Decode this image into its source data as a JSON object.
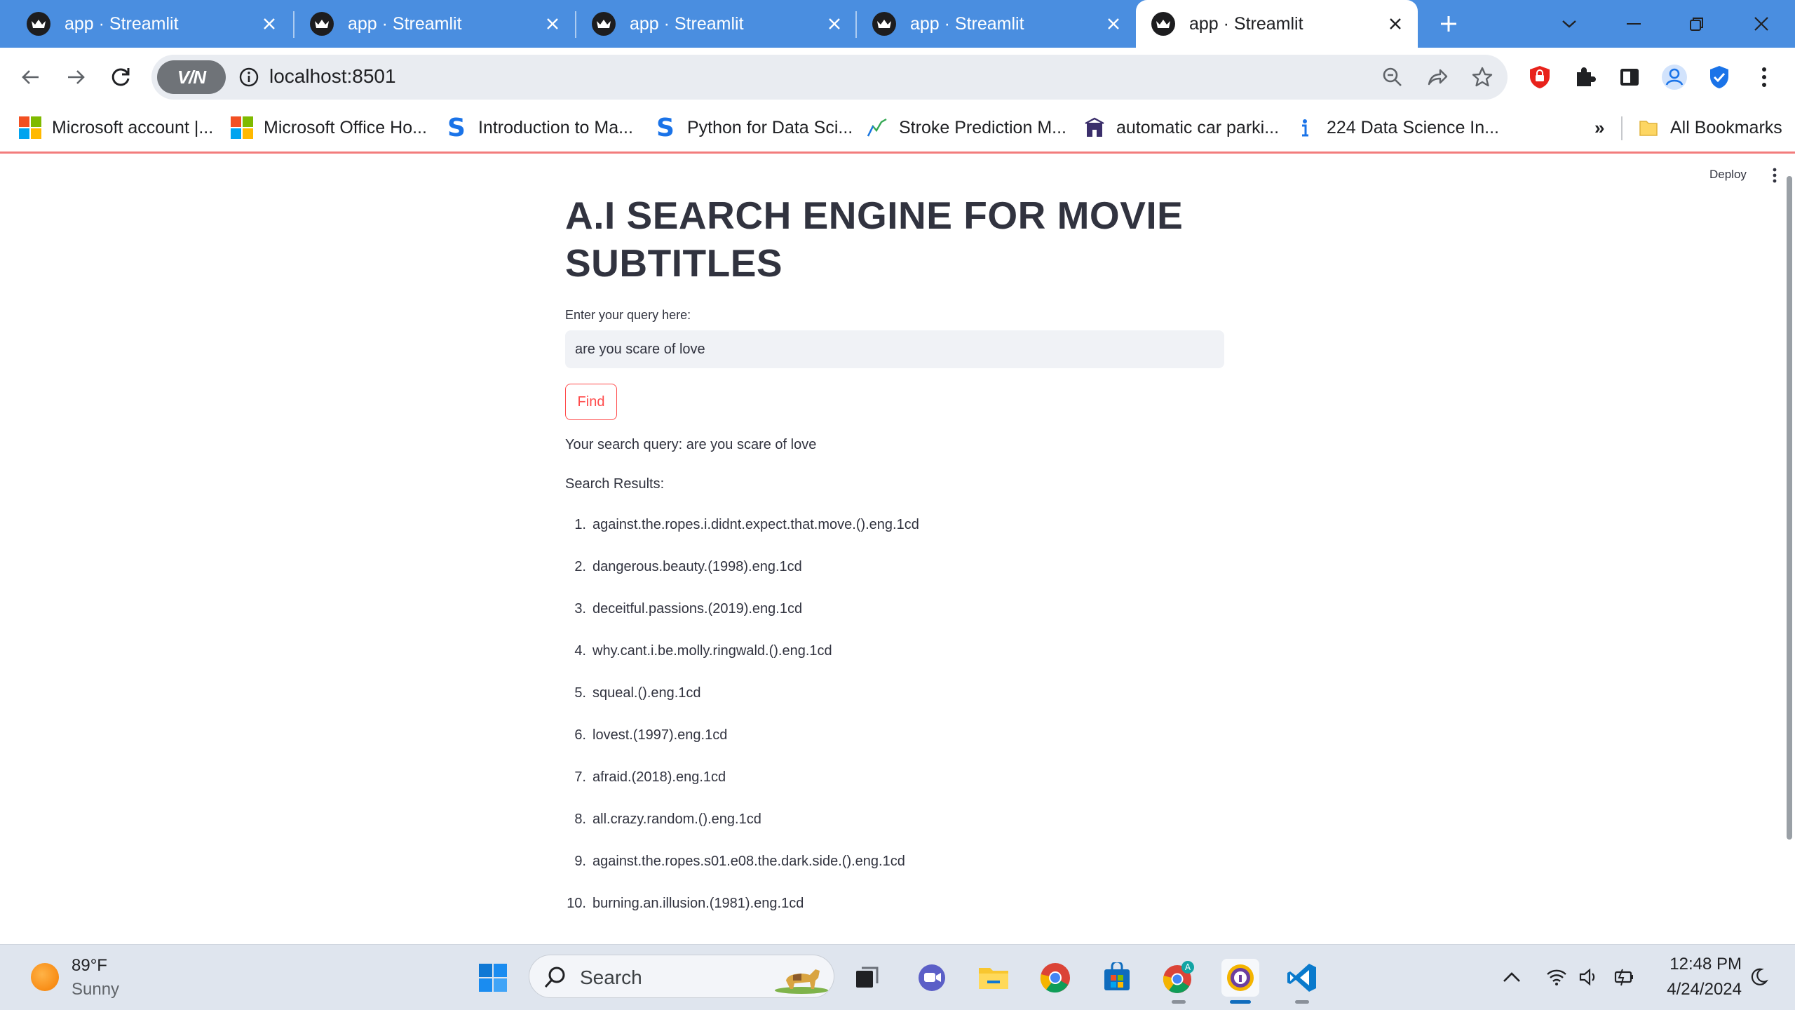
{
  "browser": {
    "tabs": [
      {
        "title": "app · Streamlit",
        "active": false
      },
      {
        "title": "app · Streamlit",
        "active": false
      },
      {
        "title": "app · Streamlit",
        "active": false
      },
      {
        "title": "app · Streamlit",
        "active": false
      },
      {
        "title": "app · Streamlit",
        "active": true
      }
    ],
    "address": {
      "vpn_label": "V/N",
      "url": "localhost:8501"
    },
    "bookmarks": [
      {
        "label": "Microsoft account |...",
        "icon": "microsoft-logo"
      },
      {
        "label": "Microsoft Office Ho...",
        "icon": "microsoft-logo"
      },
      {
        "label": "Introduction to Ma...",
        "icon": "s-logo"
      },
      {
        "label": "Python for Data Sci...",
        "icon": "s-logo"
      },
      {
        "label": "Stroke Prediction M...",
        "icon": "chart-logo"
      },
      {
        "label": "automatic car parki...",
        "icon": "building-logo"
      },
      {
        "label": "224 Data Science In...",
        "icon": "info-logo"
      }
    ],
    "bookmarks_overflow": "»",
    "all_bookmarks": "All Bookmarks"
  },
  "app": {
    "deploy_label": "Deploy",
    "title": "A.I SEARCH ENGINE FOR MOVIE SUBTITLES",
    "input_label": "Enter your query here:",
    "input_value": "are you scare of love",
    "find_label": "Find",
    "query_echo": "Your search query: are you scare of love",
    "results_label": "Search Results:",
    "results": [
      {
        "num": "1.",
        "text": "against.the.ropes.i.didnt.expect.that.move.().eng.1cd"
      },
      {
        "num": "2.",
        "text": "dangerous.beauty.(1998).eng.1cd"
      },
      {
        "num": "3.",
        "text": "deceitful.passions.(2019).eng.1cd"
      },
      {
        "num": "4.",
        "text": "why.cant.i.be.molly.ringwald.().eng.1cd"
      },
      {
        "num": "5.",
        "text": "squeal.().eng.1cd"
      },
      {
        "num": "6.",
        "text": "lovest.(1997).eng.1cd"
      },
      {
        "num": "7.",
        "text": "afraid.(2018).eng.1cd"
      },
      {
        "num": "8.",
        "text": "all.crazy.random.().eng.1cd"
      },
      {
        "num": "9.",
        "text": "against.the.ropes.s01.e08.the.dark.side.().eng.1cd"
      },
      {
        "num": "10.",
        "text": "burning.an.illusion.(1981).eng.1cd"
      }
    ]
  },
  "taskbar": {
    "weather": {
      "temp": "89°F",
      "condition": "Sunny"
    },
    "search_placeholder": "Search",
    "apps": [
      "windows-start",
      "search",
      "task-view",
      "teams",
      "file-explorer",
      "chrome",
      "microsoft-store",
      "chrome-profile",
      "vpn-app",
      "vscode"
    ],
    "clock": {
      "time": "12:48 PM",
      "date": "4/24/2024"
    }
  },
  "colors": {
    "tab_strip": "#4a8ee0",
    "streamlit_primary": "#ff4b4b",
    "text": "#31333f",
    "input_bg": "#f0f2f6"
  }
}
